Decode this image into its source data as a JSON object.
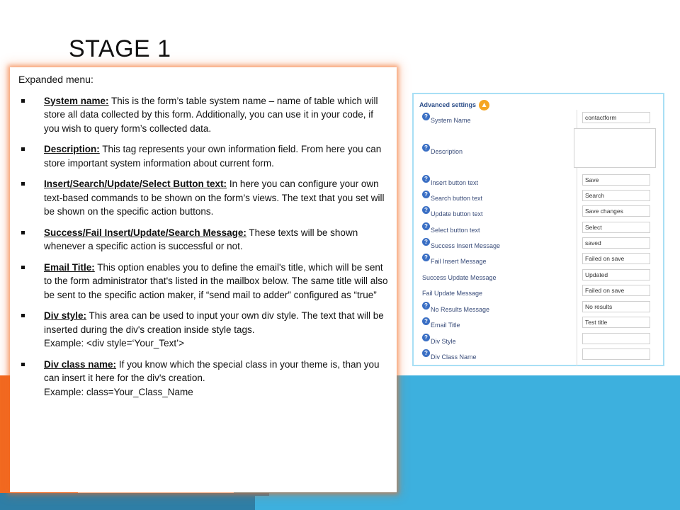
{
  "slide": {
    "title": "STAGE 1"
  },
  "description": {
    "heading": "Expanded menu:",
    "items": [
      {
        "term": "System name:",
        "text": " This is the form’s table system name – name of table which will store all data collected by this form. Additionally, you can use it in your code, if you wish to query form’s collected data.",
        "example": ""
      },
      {
        "term": "Description:",
        "text": " This tag represents your own information field. From here you can store important system information about current form.",
        "example": ""
      },
      {
        "term": "Insert/Search/Update/Select Button text:",
        "text": " In here you can configure your own text-based commands to be shown on the form’s views. The text that you set will be shown on the specific action buttons.",
        "example": ""
      },
      {
        "term": "Success/Fail Insert/Update/Search Message:",
        "text": " These texts will be shown whenever a specific action is successful or not.",
        "example": ""
      },
      {
        "term": "Email Title:",
        "text": " This option enables you to define the email's title, which will be sent to the form administrator that's listed in the mailbox below. The same title will also be sent to the specific action maker, if “send mail to adder” configured as “true”",
        "example": ""
      },
      {
        "term": "Div style:",
        "text": " This area can be used to input your own div style. The text that will be inserted during the div's creation inside style tags.",
        "example": "Example: <div style=‘Your_Text’>"
      },
      {
        "term": "Div class name:",
        "text": " If you know which the special class in your theme is, than you can insert it here for the div's creation.",
        "example": "Example: class=Your_Class_Name"
      }
    ]
  },
  "settings": {
    "title": "Advanced settings",
    "header_icon": "up-arrow-icon",
    "colors": {
      "panel_border": "#a8dff5",
      "label": "#3a4d7a",
      "help_icon": "#3a6fc4",
      "accent_orange": "#f26a21",
      "accent_blue": "#3db0de"
    },
    "rows": [
      {
        "label": "System Name",
        "value": "contactform"
      },
      {
        "label": "Description",
        "value": ""
      },
      {
        "label": "Insert button text",
        "value": "Save"
      },
      {
        "label": "Search button text",
        "value": "Search"
      },
      {
        "label": "Update button text",
        "value": "Save changes"
      },
      {
        "label": "Select button text",
        "value": "Select"
      },
      {
        "label": "Success Insert Message",
        "value": "saved"
      },
      {
        "label": "Fail Insert Message",
        "value": "Failed on save"
      },
      {
        "label": "Success Update Message",
        "value": "Updated"
      },
      {
        "label": "Fail Update Message",
        "value": "Failed on save"
      },
      {
        "label": "No Results Message",
        "value": "No results"
      },
      {
        "label": "Email Title",
        "value": "Test title"
      },
      {
        "label": "Div Style",
        "value": ""
      },
      {
        "label": "Div Class Name",
        "value": ""
      }
    ]
  }
}
